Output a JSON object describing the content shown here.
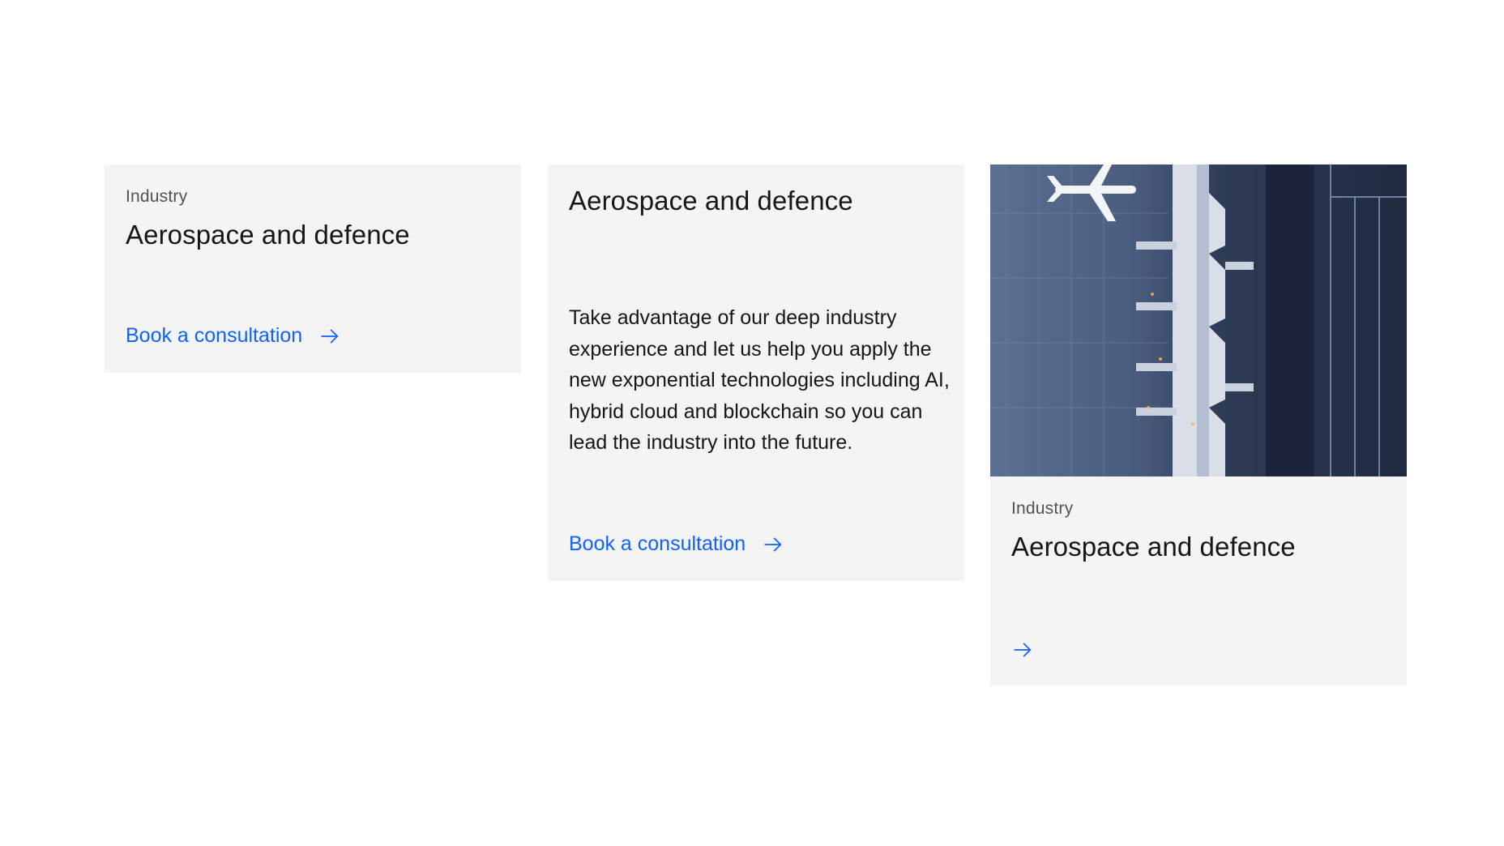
{
  "cards": [
    {
      "eyebrow": "Industry",
      "title": "Aerospace and defence",
      "cta_label": "Book a consultation",
      "cta_icon": "arrow-right-icon"
    },
    {
      "title": "Aerospace and defence",
      "body": "Take advantage of our deep industry experience and let us help you apply the new exponential technologies including AI, hybrid cloud and blockchain so you can lead the industry into the future.",
      "cta_label": "Book a consultation",
      "cta_icon": "arrow-right-icon"
    },
    {
      "image": "aerial-airport-terminal-image",
      "eyebrow": "Industry",
      "title": "Aerospace and defence",
      "cta_icon": "arrow-right-icon"
    }
  ],
  "colors": {
    "card_background": "#f4f4f4",
    "link": "#0f62fe",
    "text_primary": "#161616",
    "text_secondary": "#525252"
  }
}
